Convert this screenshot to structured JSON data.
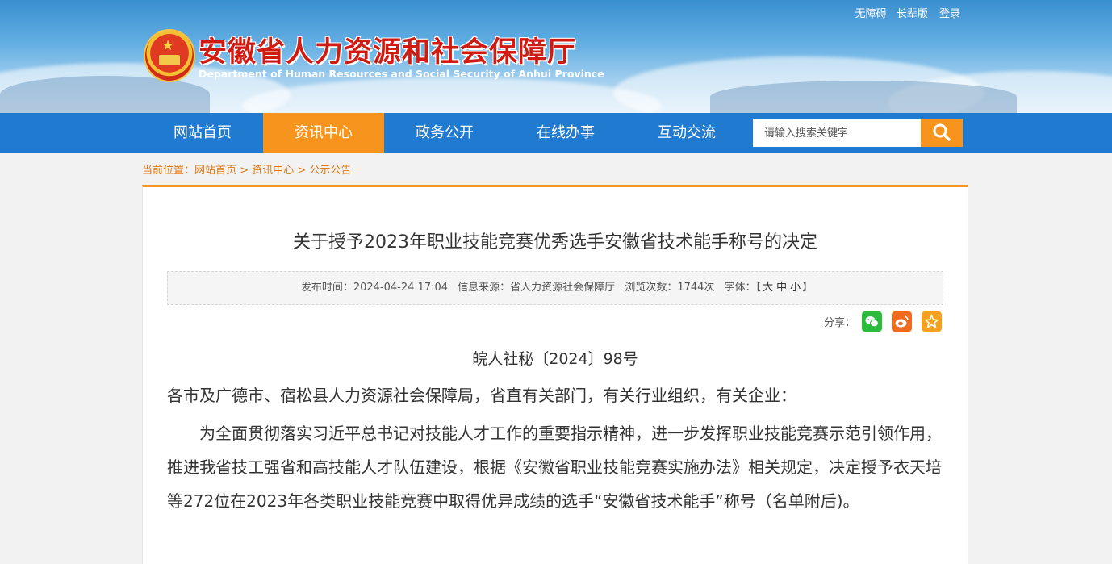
{
  "header": {
    "site_title": "安徽省人力资源和社会保障厅",
    "site_subtitle": "Department of Human Resources and Social Security of Anhui Province",
    "top_links": [
      "无障碍",
      "长辈版",
      "登录"
    ]
  },
  "nav": {
    "items": [
      "网站首页",
      "资讯中心",
      "政务公开",
      "在线办事",
      "互动交流"
    ],
    "active_index": 1
  },
  "search": {
    "placeholder": "请输入搜索关键字"
  },
  "breadcrumb": {
    "prefix": "当前位置：",
    "items": [
      "网站首页",
      "资讯中心",
      "公示公告"
    ],
    "separator": " > "
  },
  "article": {
    "title": "关于授予2023年职业技能竞赛优秀选手安徽省技术能手称号的决定",
    "meta": {
      "publish_time": "发布时间：2024-04-24 17:04",
      "source": "信息来源：省人力资源社会保障厅",
      "views": "浏览次数：1744次",
      "font_label": "字体：",
      "bracket_open": "【",
      "font_large": "大",
      "font_medium": "中",
      "font_small": "小",
      "bracket_close": "】"
    },
    "share_label": "分享：",
    "share_icons": [
      "wechat-icon",
      "weibo-icon",
      "favorite-icon"
    ],
    "doc_number": "皖人社秘〔2024〕98号",
    "salutation": "各市及广德市、宿松县人力资源社会保障局，省直有关部门，有关行业组织，有关企业：",
    "body_paragraph": "为全面贯彻落实习近平总书记对技能人才工作的重要指示精神，进一步发挥职业技能竞赛示范引领作用，推进我省技工强省和高技能人才队伍建设，根据《安徽省职业技能竞赛实施办法》相关规定，决定授予衣天培等272位在2023年各类职业技能竞赛中取得优异成绩的选手“安徽省技术能手”称号（名单附后)。"
  },
  "colors": {
    "nav_blue": "#1f7ad0",
    "accent_orange": "#f7941d",
    "title_red": "#cf1b12",
    "wechat_green": "#2dbb3d",
    "weibo_orange": "#f26b1d",
    "favorite_orange": "#f5a11e"
  }
}
